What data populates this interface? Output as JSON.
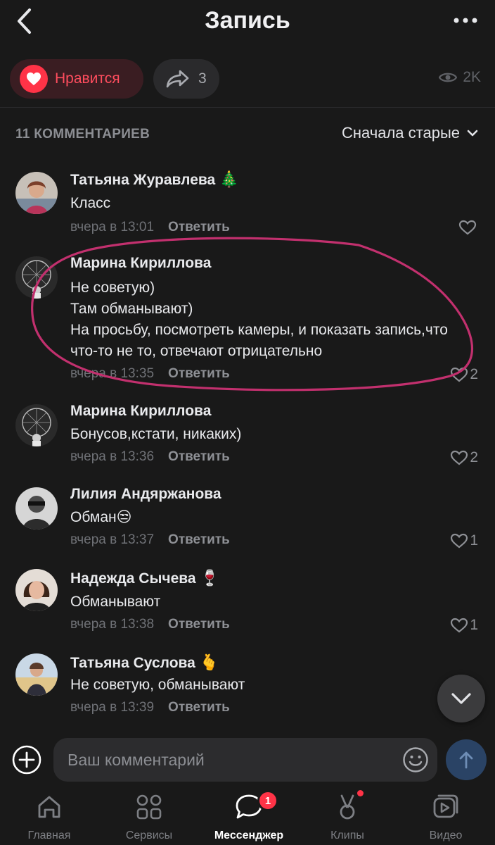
{
  "header": {
    "title": "Запись"
  },
  "actions": {
    "like_label": "Нравится",
    "share_count": "3",
    "views_count": "2K"
  },
  "comments_header": {
    "count_label": "11 КОММЕНТАРИЕВ",
    "sort_label": "Сначала старые"
  },
  "comments": [
    {
      "author": "Татьяна Журавлева",
      "emoji": "🎄",
      "text": "Класс",
      "time": "вчера в 13:01",
      "reply": "Ответить",
      "likes": ""
    },
    {
      "author": "Марина Кириллова",
      "emoji": "",
      "text": "Не советую)\nТам обманывают)\nНа просьбу, посмотреть камеры, и показать запись,что что-то не то, отвечают отрицательно",
      "time": "вчера в 13:35",
      "reply": "Ответить",
      "likes": "2"
    },
    {
      "author": "Марина Кириллова",
      "emoji": "",
      "text": "Бонусов,кстати, никаких)",
      "time": "вчера в 13:36",
      "reply": "Ответить",
      "likes": "2"
    },
    {
      "author": "Лилия Андяржанова",
      "emoji": "",
      "text": "Обман😒",
      "time": "вчера в 13:37",
      "reply": "Ответить",
      "likes": "1"
    },
    {
      "author": "Надежда Сычева",
      "emoji": "🍷",
      "text": "Обманывают",
      "time": "вчера в 13:38",
      "reply": "Ответить",
      "likes": "1"
    },
    {
      "author": "Татьяна Суслова",
      "emoji": "🫰",
      "text": "Не советую, обманывают",
      "time": "вчера в 13:39",
      "reply": "Ответить",
      "likes": ""
    }
  ],
  "composer": {
    "placeholder": "Ваш комментарий"
  },
  "nav": [
    {
      "label": "Главная",
      "icon": "home-icon"
    },
    {
      "label": "Сервисы",
      "icon": "services-icon"
    },
    {
      "label": "Мессенджер",
      "icon": "messenger-icon",
      "badge": "1"
    },
    {
      "label": "Клипы",
      "icon": "clips-icon"
    },
    {
      "label": "Видео",
      "icon": "video-icon"
    }
  ],
  "colors": {
    "background": "#191919",
    "accent_red": "#ff3347",
    "annotation": "#c2306e"
  }
}
